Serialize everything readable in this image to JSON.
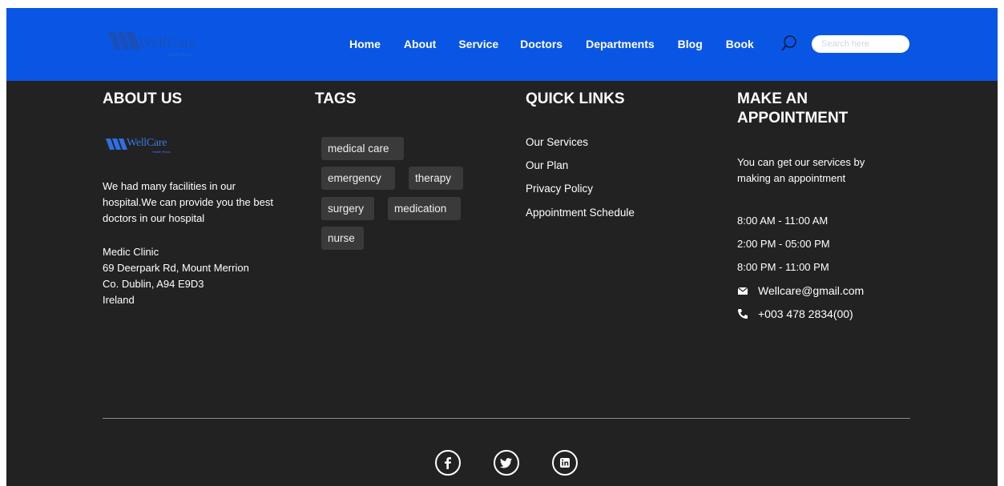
{
  "nav": {
    "brand": "WellCare",
    "brand_sub": "Health Plans",
    "links": [
      "Home",
      "About",
      "Service",
      "Doctors",
      "Departments",
      "Blog",
      "Book"
    ],
    "search_placeholder": "Search here"
  },
  "about": {
    "heading": "ABOUT US",
    "brand": "WellCare",
    "brand_sub": "Health Plans",
    "description": "We had many facilities in our hospital.We can provide you the best doctors in our hospital",
    "address": [
      "Medic Clinic",
      "69 Deerpark Rd, Mount Merrion",
      "Co. Dublin, A94 E9D3",
      "Ireland"
    ]
  },
  "tags": {
    "heading": "TAGS",
    "items": [
      "medical care",
      "emergency",
      "therapy",
      "surgery",
      "medication",
      "nurse"
    ]
  },
  "quick_links": {
    "heading": "QUICK LINKS",
    "items": [
      "Our Services",
      "Our Plan",
      "Privacy Policy",
      "Appointment Schedule"
    ]
  },
  "appointment": {
    "heading": "MAKE AN APPOINTMENT",
    "description": "You can get our services by making an appointment",
    "hours": [
      "8:00 AM - 11:00 AM",
      "2:00 PM - 05:00 PM",
      "8:00 PM - 11:00 PM"
    ],
    "email": "Wellcare@gmail.com",
    "phone": "+003 478 2834(00)"
  },
  "social": [
    "facebook-icon",
    "twitter-icon",
    "linkedin-icon"
  ],
  "colors": {
    "nav_bg": "#0a56e4",
    "footer_bg": "#222222",
    "tag_bg": "#3a3a3a",
    "logo_blue": "#1a4fb8"
  }
}
